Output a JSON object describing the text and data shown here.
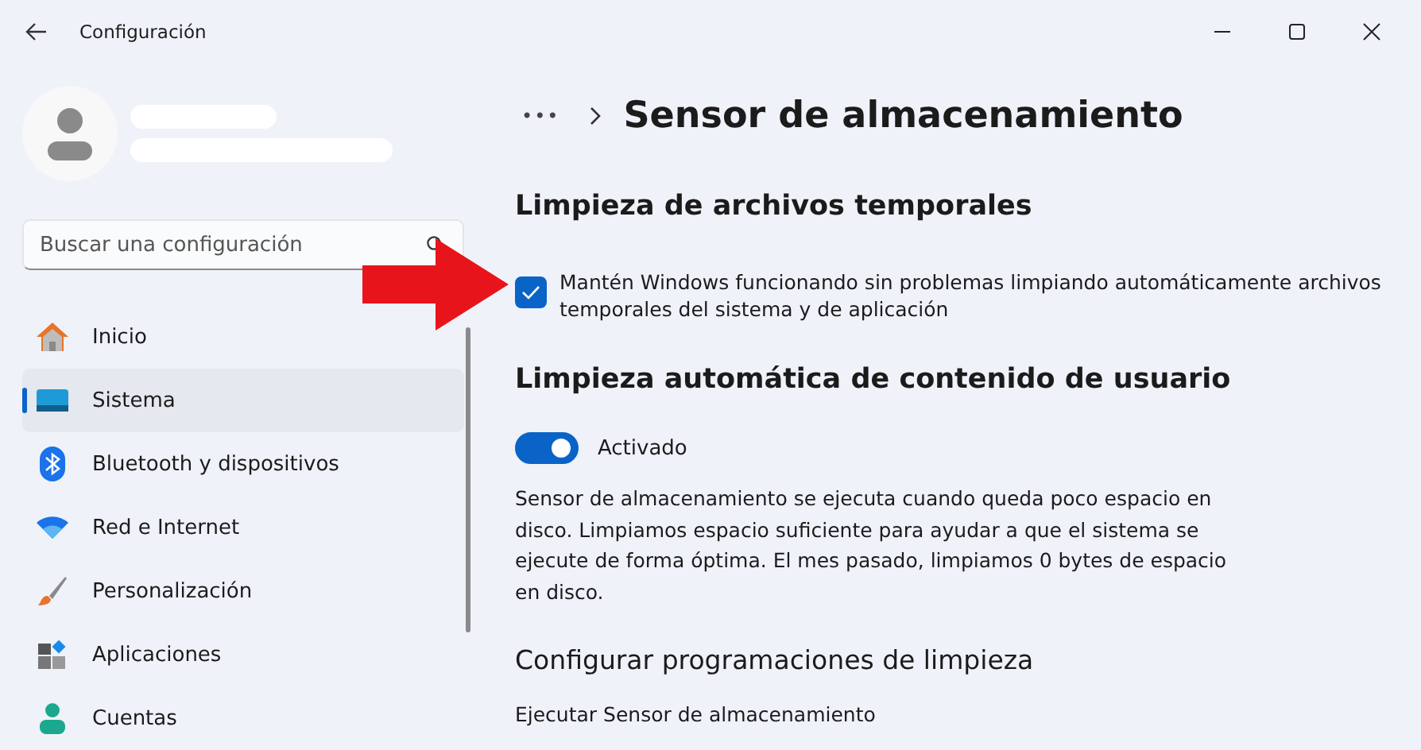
{
  "window": {
    "title": "Configuración"
  },
  "search": {
    "placeholder": "Buscar una configuración"
  },
  "nav": [
    {
      "label": "Inicio",
      "selected": false
    },
    {
      "label": "Sistema",
      "selected": true
    },
    {
      "label": "Bluetooth y dispositivos",
      "selected": false
    },
    {
      "label": "Red e Internet",
      "selected": false
    },
    {
      "label": "Personalización",
      "selected": false
    },
    {
      "label": "Aplicaciones",
      "selected": false
    },
    {
      "label": "Cuentas",
      "selected": false
    }
  ],
  "breadcrumb": {
    "more": "•••",
    "title": "Sensor de almacenamiento"
  },
  "sections": [
    {
      "heading": "Limpieza de archivos temporales",
      "kind": "checkbox",
      "checked": true,
      "text": "Mantén Windows funcionando sin problemas limpiando automáticamente archivos temporales del sistema y de aplicación"
    },
    {
      "heading": "Limpieza automática de contenido de usuario",
      "kind": "toggle",
      "on": true,
      "toggle_label": "Activado",
      "text": "Sensor de almacenamiento se ejecuta cuando queda poco espacio en disco. Limpiamos espacio suficiente para ayudar a que el sistema se ejecute de forma óptima. El mes pasado, limpiamos 0 bytes de espacio en disco."
    }
  ],
  "schedule": {
    "heading": "Configurar programaciones de limpieza",
    "label": "Ejecutar Sensor de almacenamiento"
  }
}
